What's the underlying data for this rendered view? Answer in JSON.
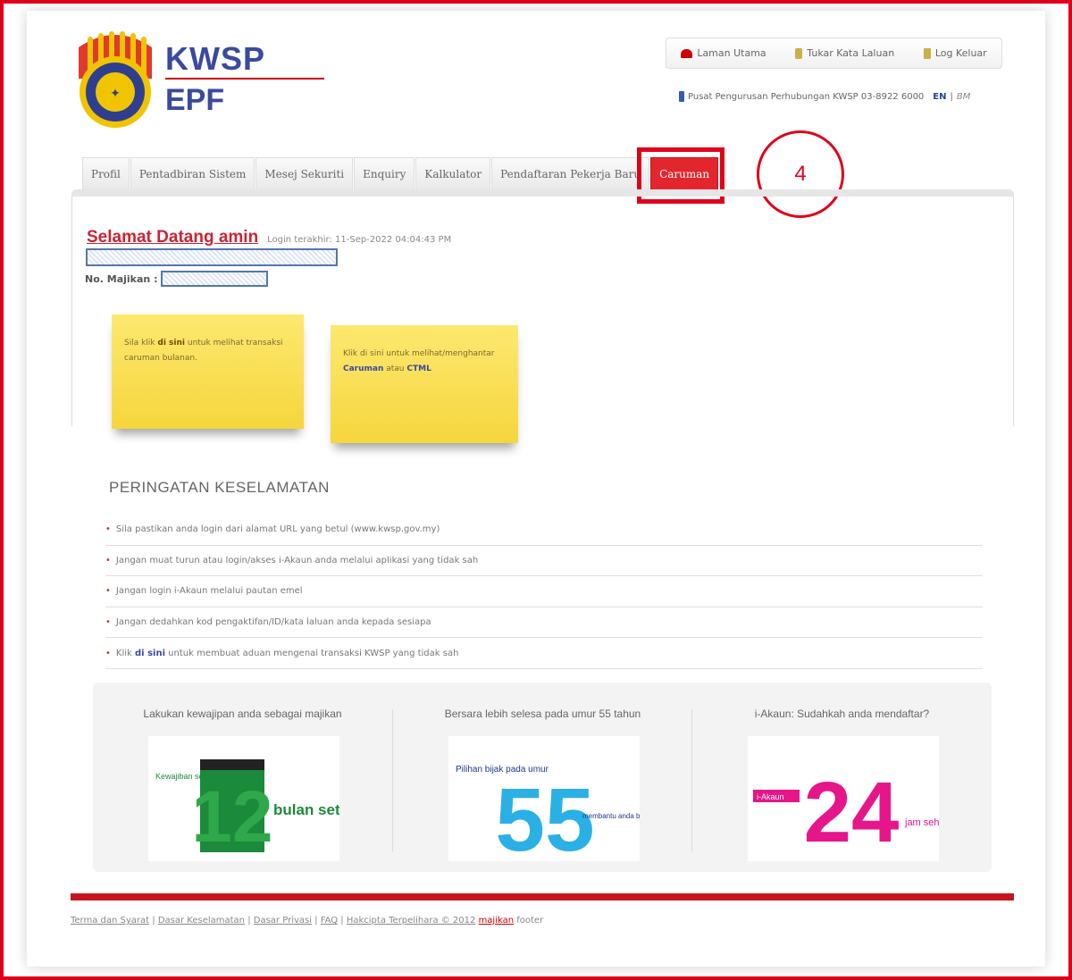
{
  "brand": {
    "line1": "KWSP",
    "line2": "EPF"
  },
  "toplinks": [
    {
      "label": "Laman Utama",
      "icon": "home-icon"
    },
    {
      "label": "Tukar Kata Laluan",
      "icon": "lock-icon"
    },
    {
      "label": "Log Keluar",
      "icon": "logout-icon"
    }
  ],
  "contact": {
    "text": "Pusat Pengurusan Perhubungan KWSP 03-8922 6000",
    "lang_en": "EN",
    "lang_sep": "|",
    "lang_bm": "BM"
  },
  "tabs": [
    "Profil",
    "Pentadbiran Sistem",
    "Mesej Sekuriti",
    "Enquiry",
    "Kalkulator",
    "Pendaftaran Pekerja Baru",
    "Caruman"
  ],
  "active_tab": "Caruman",
  "annotation_number": "4",
  "welcome": {
    "greeting": "Selamat Datang amin",
    "last_login": "Login terakhir: 11-Sep-2022 04:04:43 PM"
  },
  "employer_label": "No. Majikan :",
  "note1": {
    "pre": "Sila klik ",
    "link": "di sini",
    "post": " untuk melihat transaksi caruman bulanan."
  },
  "note2": {
    "pre": "Klik di sini untuk melihat/menghantar ",
    "link1": "Caruman",
    "mid": " atau ",
    "link2": "CTML"
  },
  "security": {
    "title": "PERINGATAN KESELAMATAN",
    "items": [
      "Sila pastikan anda login dari alamat URL yang betul (www.kwsp.gov.my)",
      "Jangan muat turun atau login/akses i-Akaun anda melalui aplikasi yang tidak sah",
      "Jangan login i-Akaun melalui pautan emel",
      "Jangan dedahkan kod pengaktifan/ID/kata laluan anda kepada sesiapa"
    ],
    "last_pre": "Klik ",
    "last_link": "di sini",
    "last_post": " untuk membuat aduan mengenai transaksi KWSP yang tidak sah"
  },
  "promos": [
    {
      "title": "Lakukan kewajipan anda sebagai majikan",
      "big": "12",
      "small1": "Kewajiban setiap majikan",
      "small2": "bulan setahun"
    },
    {
      "title": "Bersara lebih selesa pada umur 55 tahun",
      "big": "55",
      "small1": "Pilihan bijak pada umur",
      "small2": "membantu anda bersara lebih selesa"
    },
    {
      "title": "i-Akaun: Sudahkah anda mendaftar?",
      "big": "24",
      "small1": "i-Akaun",
      "small2": "jam sehari"
    }
  ],
  "footer": {
    "links": [
      "Terma dan Syarat",
      "Dasar Keselamatan",
      "Dasar Privasi",
      "FAQ",
      "Hakcipta Terpelihara © 2012"
    ],
    "red": "majikan",
    "tail": " footer"
  },
  "colors": {
    "accent": "#e0001a",
    "brand_blue": "#3a4a9e",
    "note_yellow": "#f6d63d",
    "tab_active": "#e3262e"
  }
}
